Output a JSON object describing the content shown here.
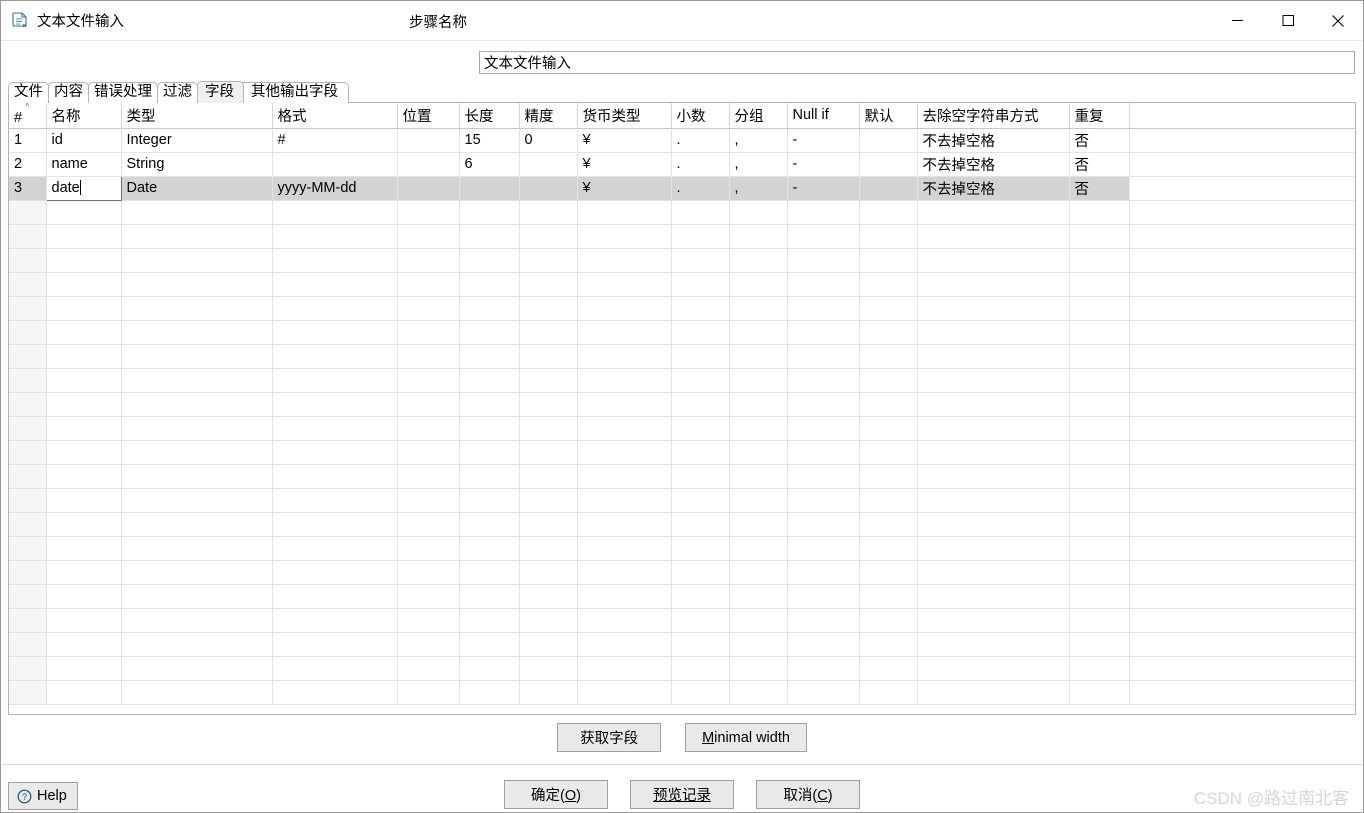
{
  "window": {
    "title": "文本文件输入",
    "icon": "file-document-icon",
    "controls": {
      "minimize": "minimize-icon",
      "maximize": "maximize-icon",
      "close": "close-icon"
    }
  },
  "step": {
    "label": "步骤名称",
    "value": "文本文件输入",
    "placeholder": ""
  },
  "tabs": [
    {
      "label": "文件",
      "active": false
    },
    {
      "label": "内容",
      "active": false
    },
    {
      "label": "错误处理",
      "active": false
    },
    {
      "label": "过滤",
      "active": false
    },
    {
      "label": "字段",
      "active": true
    },
    {
      "label": "其他输出字段",
      "active": false
    }
  ],
  "table": {
    "columns": [
      "#",
      "名称",
      "类型",
      "格式",
      "位置",
      "长度",
      "精度",
      "货币类型",
      "小数",
      "分组",
      "Null if",
      "默认",
      "去除空字符串方式",
      "重复"
    ],
    "rows": [
      {
        "num": "1",
        "名称": "id",
        "类型": "Integer",
        "格式": "#",
        "位置": "",
        "长度": "15",
        "精度": "0",
        "货币类型": "¥",
        "小数": ".",
        "分组": ",",
        "Null if": "-",
        "默认": "",
        "去除空字符串方式": "不去掉空格",
        "重复": "否",
        "selected": false,
        "editing": false
      },
      {
        "num": "2",
        "名称": "name",
        "类型": "String",
        "格式": "",
        "位置": "",
        "长度": "6",
        "精度": "",
        "货币类型": "¥",
        "小数": ".",
        "分组": ",",
        "Null if": "-",
        "默认": "",
        "去除空字符串方式": "不去掉空格",
        "重复": "否",
        "selected": false,
        "editing": false
      },
      {
        "num": "3",
        "名称": "date",
        "类型": "Date",
        "格式": "yyyy-MM-dd",
        "位置": "",
        "长度": "",
        "精度": "",
        "货币类型": "¥",
        "小数": ".",
        "分组": ",",
        "Null if": "-",
        "默认": "",
        "去除空字符串方式": "不去掉空格",
        "重复": "否",
        "selected": true,
        "editing": true
      }
    ],
    "empty_row_count": 21
  },
  "mid_buttons": [
    {
      "label": "获取字段",
      "name": "get-fields-button",
      "mnemonic": ""
    },
    {
      "label": "Minimal width",
      "name": "minimal-width-button",
      "mnemonic": "M"
    }
  ],
  "bottom_buttons": [
    {
      "label": "确定(O)",
      "name": "ok-button",
      "mnemonic": "O"
    },
    {
      "label": "预览记录",
      "name": "preview-records-button",
      "mnemonic": ""
    },
    {
      "label": "取消(C)",
      "name": "cancel-button",
      "mnemonic": "C"
    }
  ],
  "help": {
    "label": "Help",
    "icon": "help-circle-icon"
  },
  "watermark": "CSDN @路过南北客",
  "colors": {
    "selected_row": "#d3d3d3",
    "button_face": "#e9e9e9",
    "grid_line": "#e3e3e3",
    "watermark": "#d6d6d6",
    "active_tab": "#f0f0f0"
  }
}
